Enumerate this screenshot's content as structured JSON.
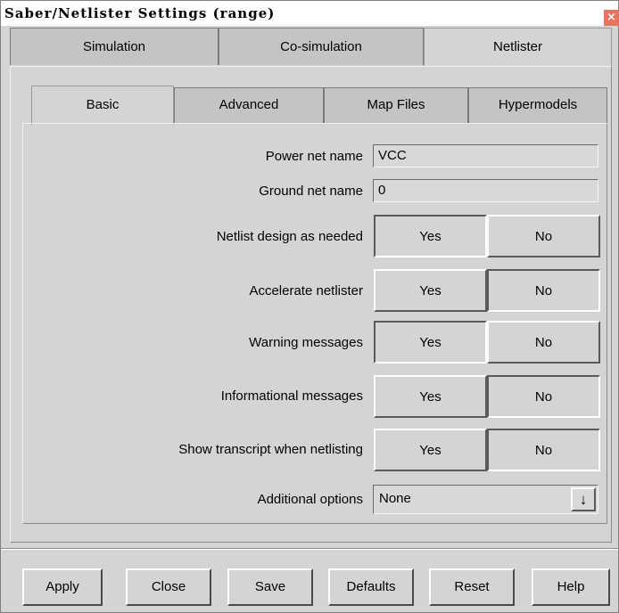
{
  "window": {
    "title": "Saber/Netlister Settings (range)",
    "close_glyph": "×"
  },
  "outer_tabs": [
    {
      "label": "Simulation"
    },
    {
      "label": "Co-simulation"
    },
    {
      "label": "Netlister",
      "active": true
    }
  ],
  "inner_tabs": [
    {
      "label": "Basic",
      "active": true
    },
    {
      "label": "Advanced"
    },
    {
      "label": "Map Files"
    },
    {
      "label": "Hypermodels"
    }
  ],
  "fields": {
    "power_net": {
      "label": "Power net name",
      "value": "VCC"
    },
    "ground_net": {
      "label": "Ground net name",
      "value": "0"
    }
  },
  "toggles": [
    {
      "label": "Netlist design as needed",
      "yes": "Yes",
      "no": "No",
      "selected": "Yes"
    },
    {
      "label": "Accelerate netlister",
      "yes": "Yes",
      "no": "No",
      "selected": "No"
    },
    {
      "label": "Warning messages",
      "yes": "Yes",
      "no": "No",
      "selected": "Yes"
    },
    {
      "label": "Informational messages",
      "yes": "Yes",
      "no": "No",
      "selected": "No"
    },
    {
      "label": "Show transcript when netlisting",
      "yes": "Yes",
      "no": "No",
      "selected": "No"
    }
  ],
  "additional_options": {
    "label": "Additional options",
    "value": "None",
    "arrow_glyph": "↓"
  },
  "buttons": {
    "apply": "Apply",
    "close": "Close",
    "save": "Save",
    "defaults": "Defaults",
    "reset": "Reset",
    "help": "Help"
  },
  "colors": {
    "face": "#d4d4d4",
    "close": "#e8745f"
  }
}
